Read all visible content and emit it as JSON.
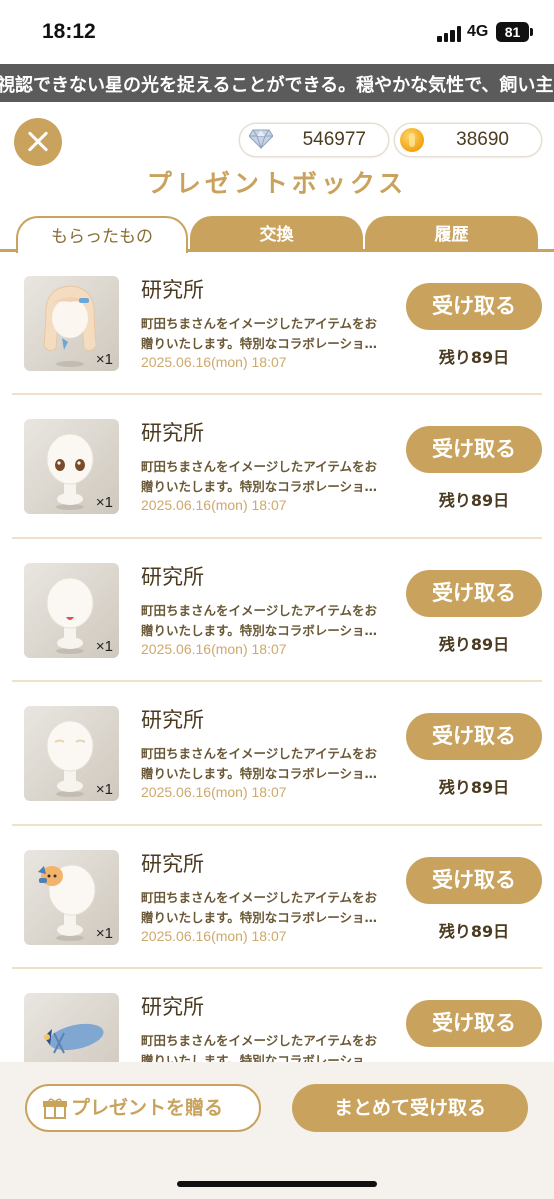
{
  "status_bar": {
    "time": "18:12",
    "network": "4G",
    "battery": "81"
  },
  "ticker": {
    "text": "視認できない星の光を捉えることができる。穏やかな気性で、飼い主や"
  },
  "header": {
    "gems": "546977",
    "coins": "38690",
    "title": "プレゼントボックス"
  },
  "tabs": [
    {
      "label": "もらったもの",
      "active": true
    },
    {
      "label": "交換",
      "active": false
    },
    {
      "label": "履歴",
      "active": false
    }
  ],
  "items": [
    {
      "title": "研究所",
      "desc_line1": "町田ちまさんをイメージしたアイテムをお",
      "desc_line2": "贈りいたします。特別なコラボレーショ…",
      "date": "2025.06.16(mon) 18:07",
      "qty": "×1",
      "button": "受け取る",
      "remaining": "残り89日",
      "thumb": "hair"
    },
    {
      "title": "研究所",
      "desc_line1": "町田ちまさんをイメージしたアイテムをお",
      "desc_line2": "贈りいたします。特別なコラボレーショ…",
      "date": "2025.06.16(mon) 18:07",
      "qty": "×1",
      "button": "受け取る",
      "remaining": "残り89日",
      "thumb": "eyes"
    },
    {
      "title": "研究所",
      "desc_line1": "町田ちまさんをイメージしたアイテムをお",
      "desc_line2": "贈りいたします。特別なコラボレーショ…",
      "date": "2025.06.16(mon) 18:07",
      "qty": "×1",
      "button": "受け取る",
      "remaining": "残り89日",
      "thumb": "mouth"
    },
    {
      "title": "研究所",
      "desc_line1": "町田ちまさんをイメージしたアイテムをお",
      "desc_line2": "贈りいたします。特別なコラボレーショ…",
      "date": "2025.06.16(mon) 18:07",
      "qty": "×1",
      "button": "受け取る",
      "remaining": "残り89日",
      "thumb": "brows"
    },
    {
      "title": "研究所",
      "desc_line1": "町田ちまさんをイメージしたアイテムをお",
      "desc_line2": "贈りいたします。特別なコラボレーショ…",
      "date": "2025.06.16(mon) 18:07",
      "qty": "×1",
      "button": "受け取る",
      "remaining": "残り89日",
      "thumb": "accessory"
    },
    {
      "title": "研究所",
      "desc_line1": "町田ちまさんをイメージしたアイテムをお",
      "desc_line2": "贈りいたします。特別なコラボレーショ…",
      "date": "",
      "qty": "",
      "button": "受け取る",
      "remaining": "",
      "thumb": "hat"
    }
  ],
  "footer": {
    "gift_button": "プレゼントを贈る",
    "claim_all_button": "まとめて受け取る"
  },
  "colors": {
    "accent": "#c9a35d",
    "ticker_bg": "#5b5b5b",
    "footer_bg": "#f5f2ed"
  }
}
